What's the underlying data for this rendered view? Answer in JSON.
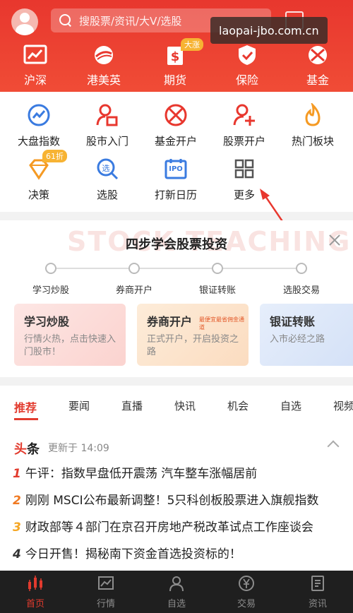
{
  "header": {
    "search_placeholder": "搜股票/资讯/大V/选股",
    "watermark": "laopai-jbo.com.cn",
    "tabs": [
      {
        "label": "沪深",
        "icon": "chart-line-icon"
      },
      {
        "label": "港美英",
        "icon": "globe-icon"
      },
      {
        "label": "期货",
        "icon": "dollar-ticket-icon",
        "badge": "大涨"
      },
      {
        "label": "保险",
        "icon": "shield-icon"
      },
      {
        "label": "基金",
        "icon": "fund-ball-icon"
      }
    ]
  },
  "shortcuts": [
    {
      "label": "大盘指数",
      "icon": "trend-circle-icon"
    },
    {
      "label": "股市入门",
      "icon": "person-book-icon"
    },
    {
      "label": "基金开户",
      "icon": "fund-ball-icon"
    },
    {
      "label": "股票开户",
      "icon": "person-add-icon"
    },
    {
      "label": "热门板块",
      "icon": "flame-icon"
    },
    {
      "label": "决策",
      "icon": "diamond-icon",
      "badge": "61折"
    },
    {
      "label": "选股",
      "icon": "magnifier-icon"
    },
    {
      "label": "打新日历",
      "icon": "ipo-calendar-icon",
      "icon_text": "IPO"
    },
    {
      "label": "更多",
      "icon": "grid-icon"
    }
  ],
  "learn_card": {
    "bg_text": "STOCK TEACHING",
    "title": "四步学会股票投资",
    "steps": [
      "学习炒股",
      "券商开户",
      "银证转账",
      "选股交易"
    ],
    "cards": [
      {
        "title": "学习炒股",
        "desc": "行情火热，点击快速入门股市！"
      },
      {
        "title": "券商开户",
        "desc": "正式开户，开启投资之路",
        "tag": "最便宜最省佣金通道"
      },
      {
        "title": "银证转账",
        "desc": "入市必经之路"
      }
    ]
  },
  "news": {
    "tabs": [
      "推荐",
      "要闻",
      "直播",
      "快讯",
      "机会",
      "自选",
      "视频"
    ],
    "section_title_a": "头",
    "section_title_b": "条",
    "updated": "更新于 14:09",
    "items": [
      {
        "num": "1",
        "text": "午评：指数早盘低开震荡 汽车整车涨幅居前",
        "color": "#e23b2e"
      },
      {
        "num": "2",
        "text": "刚刚 MSCI公布最新调整！5只科创板股票进入旗舰指数",
        "color": "#f07a22"
      },
      {
        "num": "3",
        "text": "财政部等４部门在京召开房地产税改革试点工作座谈会",
        "color": "#f5a623"
      },
      {
        "num": "4",
        "text": "今日开售！揭秘南下资金首选投资标的！",
        "color": "#333333"
      }
    ]
  },
  "bottom_tabs": [
    {
      "label": "首页",
      "icon": "candlestick-icon",
      "active": true
    },
    {
      "label": "行情",
      "icon": "market-chart-icon",
      "active": false
    },
    {
      "label": "自选",
      "icon": "person-icon",
      "active": false
    },
    {
      "label": "交易",
      "icon": "yuan-icon",
      "active": false
    },
    {
      "label": "资讯",
      "icon": "document-icon",
      "active": false
    }
  ],
  "colors": {
    "brand_red": "#e8372e",
    "accent_orange": "#f5a623",
    "icon_red": "#e8372e",
    "icon_blue": "#3a7be0",
    "icon_orange": "#f59a23"
  }
}
